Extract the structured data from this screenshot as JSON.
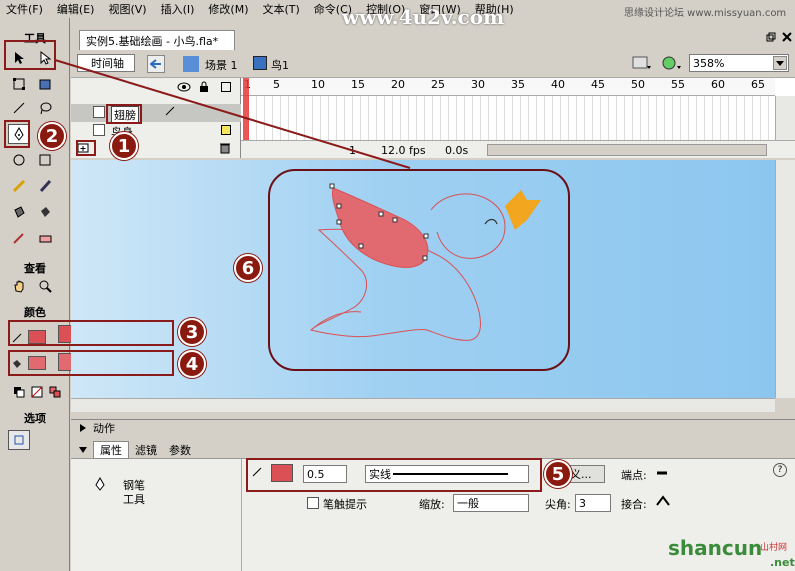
{
  "menu": [
    "文件(F)",
    "编辑(E)",
    "视图(V)",
    "插入(I)",
    "修改(M)",
    "文本(T)",
    "命令(C)",
    "控制(O)",
    "窗口(W)",
    "帮助(H)"
  ],
  "watermarks": {
    "site": "www.4u2v.com",
    "forum": "思缘设计论坛 www.missyuan.com",
    "shancun": "shancun",
    "shancun_small": "山村网",
    "net": ".net"
  },
  "tools": {
    "title": "工具",
    "view_title": "查看",
    "color_title": "颜色",
    "options_title": "选项"
  },
  "stroke_color_hex": "#DA5054",
  "fill_color_hex": "#E16A71",
  "document": {
    "tab_title": "实例5.基础绘画 - 小鸟.fla*",
    "timeline_button": "时间轴",
    "scene_label": "场景 1",
    "symbol_label": "鸟1",
    "zoom": "358%"
  },
  "timeline": {
    "layers": [
      "翅膀",
      "鸟身"
    ],
    "frame_numbers": [
      "1",
      "5",
      "10",
      "15",
      "20",
      "25",
      "30",
      "35",
      "40",
      "45",
      "50",
      "55",
      "60",
      "65"
    ],
    "current_frame": "1",
    "fps": "12.0 fps",
    "time": "0.0s"
  },
  "panels": {
    "actions": "动作",
    "properties_tab": "属性",
    "filters_tab": "滤镜",
    "params_tab": "参数"
  },
  "properties": {
    "tool_name_line1": "钢笔",
    "tool_name_line2": "工具",
    "stroke_width": "0.5",
    "stroke_style": "实线",
    "custom_button": "定义...",
    "stroke_hint_label": "笔触提示",
    "scale_label": "缩放:",
    "scale_value": "一般",
    "cap_label": "端点:",
    "join_label": "接合:",
    "miter_label": "尖角:",
    "miter_value": "3"
  },
  "callouts": [
    "1",
    "2",
    "3",
    "4",
    "5",
    "6"
  ],
  "colors": {
    "wing_fill": "#E16A71",
    "stroke": "#DA5054",
    "beak": "#F2A51E",
    "callout": "#8A1A10",
    "stage_sky": "#9FD0F2"
  }
}
